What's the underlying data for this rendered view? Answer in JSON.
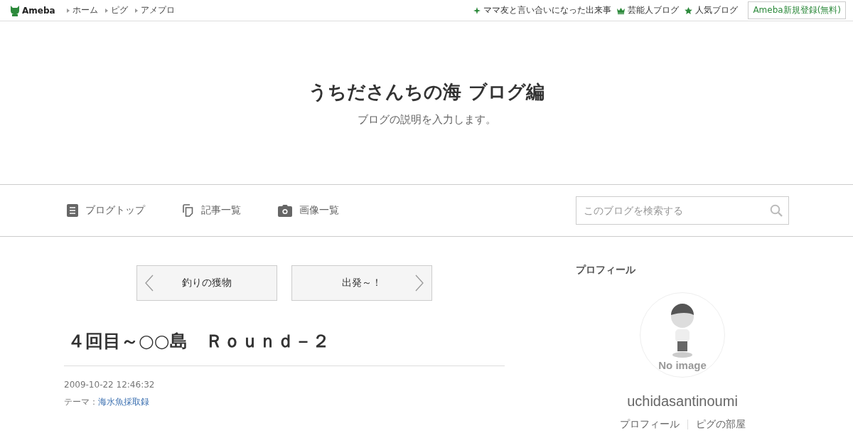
{
  "topbar": {
    "logo": "Ameba",
    "links": [
      "ホーム",
      "ピグ",
      "アメプロ"
    ],
    "right_links": [
      {
        "kind": "sparkle",
        "label": "ママ友と言い合いになった出来事"
      },
      {
        "kind": "crown",
        "label": "芸能人ブログ"
      },
      {
        "kind": "star",
        "label": "人気ブログ"
      }
    ],
    "register": "Ameba新規登録(無料)"
  },
  "blog": {
    "title": "うちださんちの海 ブログ編",
    "description": "ブログの説明を入力します。"
  },
  "nav": {
    "items": [
      {
        "kind": "doc",
        "label": "ブログトップ"
      },
      {
        "kind": "pages",
        "label": "記事一覧"
      },
      {
        "kind": "camera",
        "label": "画像一覧"
      }
    ],
    "search": {
      "placeholder": "このブログを検索する"
    }
  },
  "pager": {
    "prev": "釣りの獲物",
    "next": "出発～！"
  },
  "article": {
    "title": "４回目～○○島　Ｒｏｕｎｄ－２",
    "date": "2009-10-22 12:46:32",
    "theme_label": "テーマ：",
    "theme": "海水魚採取録"
  },
  "profile": {
    "heading": "プロフィール",
    "avatar_caption": "No image",
    "name": "uchidasantinoumi",
    "links": [
      "プロフィール",
      "ピグの部屋"
    ]
  }
}
